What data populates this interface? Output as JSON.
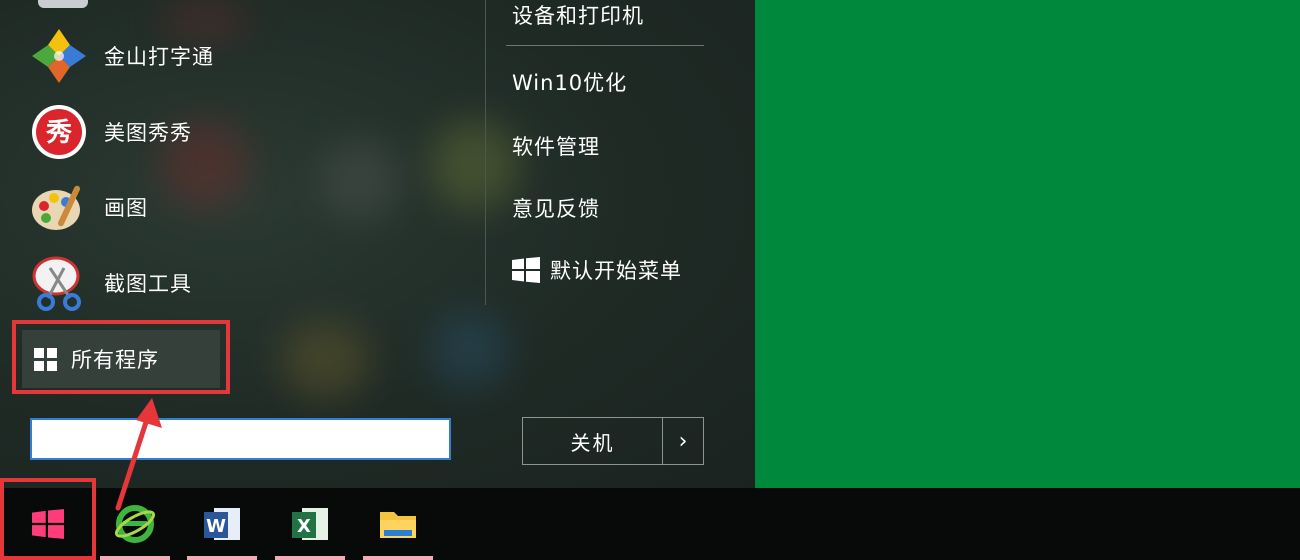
{
  "start_menu": {
    "apps": [
      {
        "label": "金山打字通",
        "icon": "jinshan-typing-icon"
      },
      {
        "label": "美图秀秀",
        "icon": "meitu-xiuxiu-icon",
        "icon_text": "秀"
      },
      {
        "label": "画图",
        "icon": "paint-palette-icon"
      },
      {
        "label": "截图工具",
        "icon": "snipping-tool-icon"
      }
    ],
    "all_programs_label": "所有程序",
    "search": {
      "value": "",
      "placeholder": ""
    },
    "right_links": [
      {
        "label": "设备和打印机"
      },
      {
        "label": "Win10优化"
      },
      {
        "label": "软件管理"
      },
      {
        "label": "意见反馈"
      },
      {
        "label": "默认开始菜单",
        "icon": "windows-logo-icon"
      }
    ],
    "shutdown_label": "关机",
    "shutdown_arrow": "›"
  },
  "taskbar": {
    "start_icon": "windows-logo-icon",
    "pinned": [
      {
        "name": "ie-browser",
        "icon": "ie-browser-icon"
      },
      {
        "name": "word",
        "icon": "word-icon",
        "icon_text": "W"
      },
      {
        "name": "excel",
        "icon": "excel-icon",
        "icon_text": "X"
      },
      {
        "name": "file-explorer",
        "icon": "folder-icon"
      }
    ]
  },
  "colors": {
    "highlight": "#e5363a",
    "desktop": "#00883c",
    "start_logo": "#ff3d7a"
  }
}
